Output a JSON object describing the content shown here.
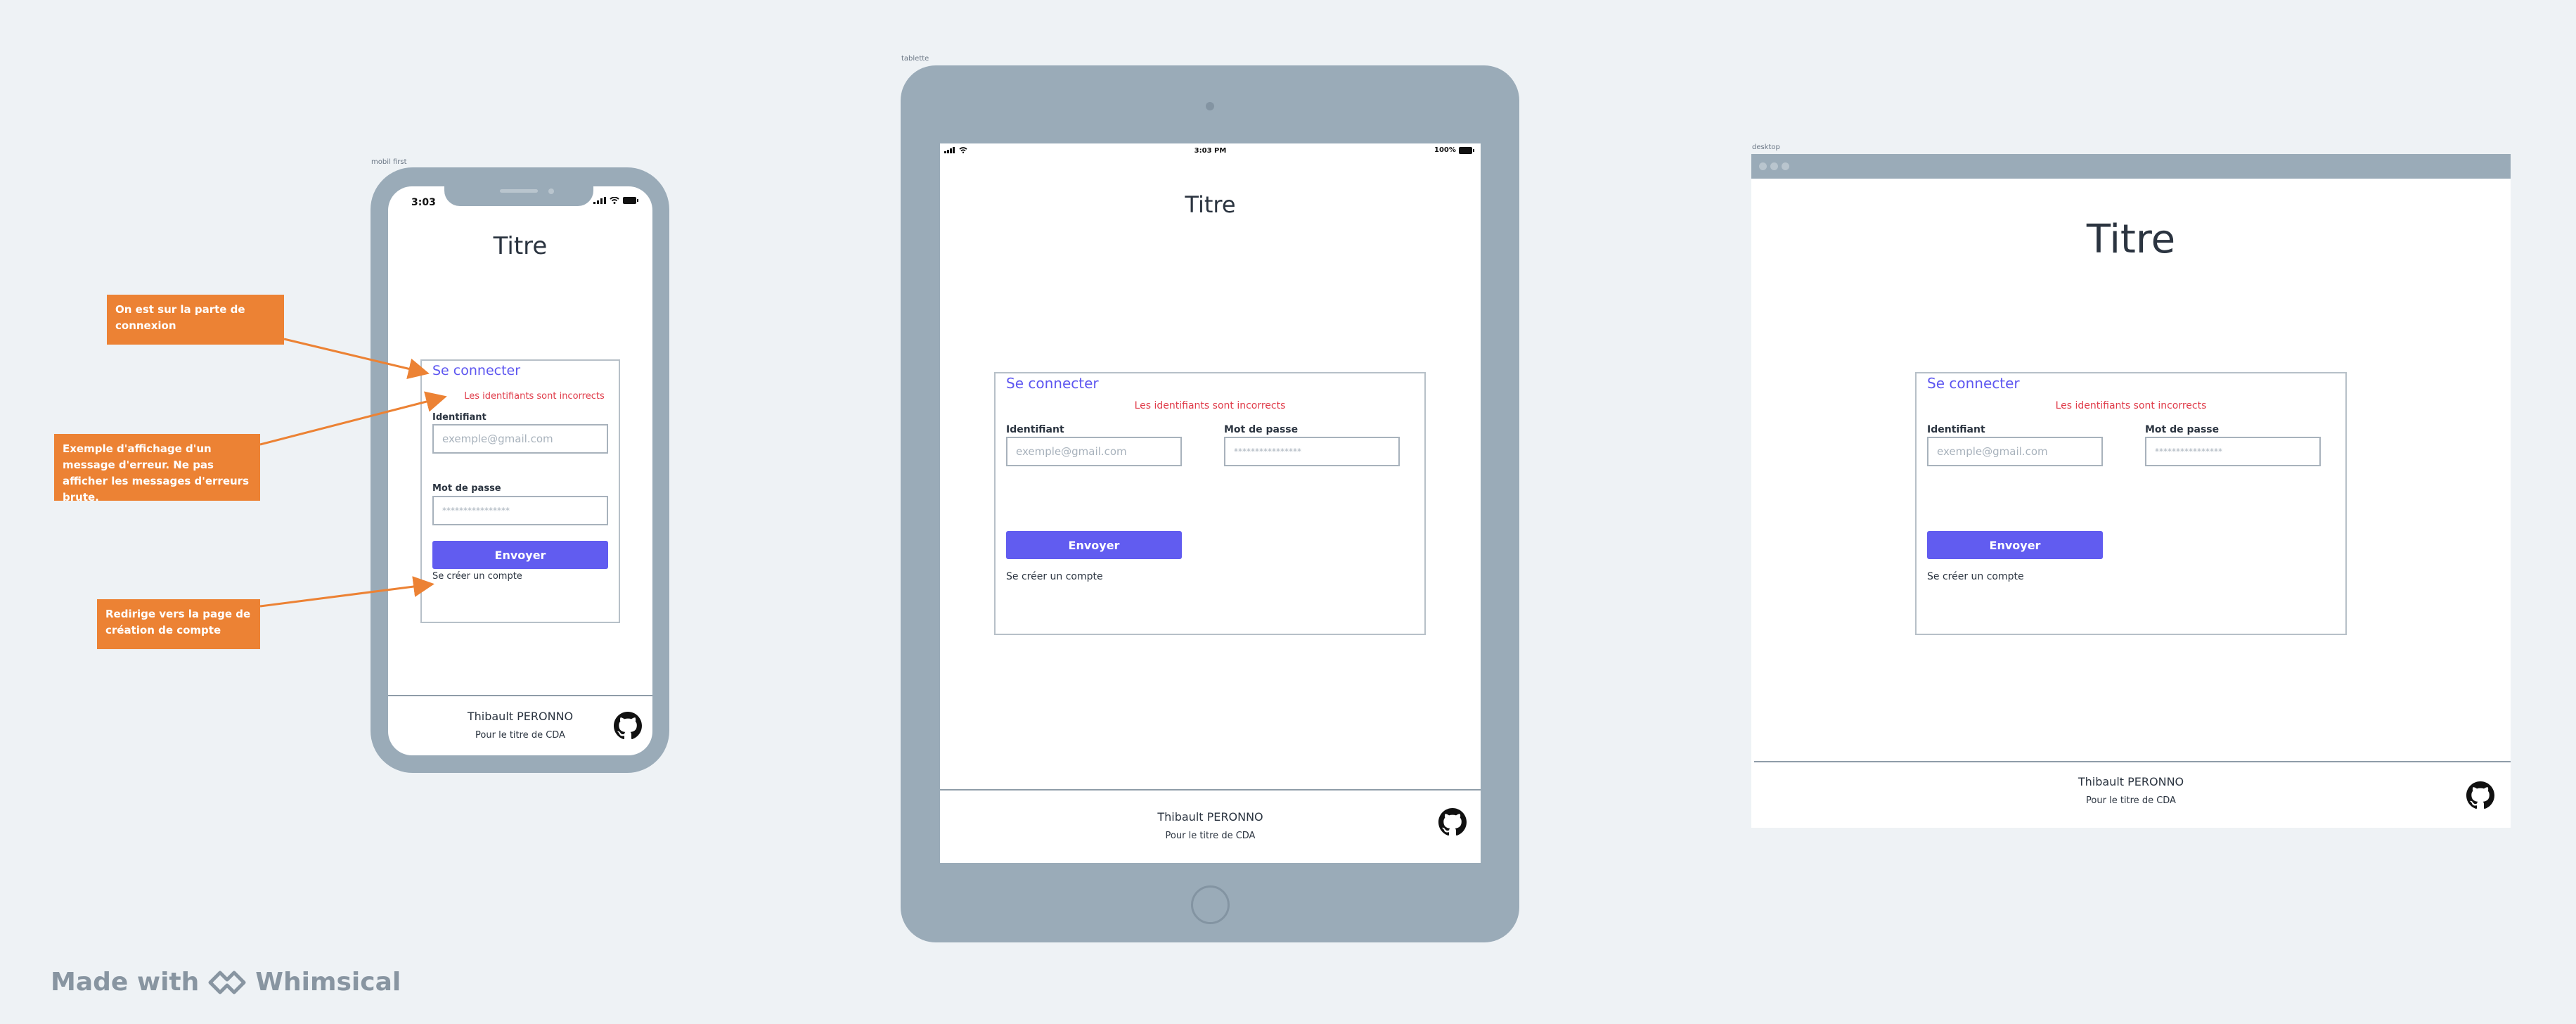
{
  "frames": {
    "mobile_label": "mobil first",
    "tablet_label": "tablette",
    "desktop_label": "desktop"
  },
  "mobile": {
    "status_time": "3:03"
  },
  "tablet": {
    "status_time": "3:03 PM",
    "battery": "100%"
  },
  "page": {
    "title": "Titre",
    "card_title": "Se connecter",
    "error": "Les identifiants sont incorrects",
    "id_label": "Identifiant",
    "id_placeholder": "exemple@gmail.com",
    "pwd_label": "Mot de passe",
    "pwd_placeholder": "****************",
    "submit": "Envoyer",
    "create_account": "Se créer un compte"
  },
  "footer": {
    "name": "Thibault PERONNO",
    "subtitle": "Pour le titre de CDA",
    "icon": "github-icon"
  },
  "notes": {
    "login": "On est sur la parte de connexion",
    "error": "Exemple d'affichage d'un message d'erreur. Ne pas afficher les messages d'erreurs brute.",
    "redirect": "Redirige vers la page de création de compte"
  },
  "branding": {
    "made_with": "Made with",
    "brand": "Whimsical"
  },
  "colors": {
    "accent": "#615cf0",
    "error": "#e03c4a",
    "note": "#ec8234",
    "device": "#9aabb8"
  }
}
